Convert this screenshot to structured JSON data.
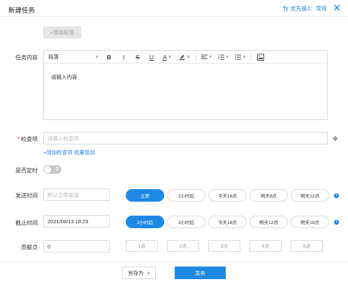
{
  "header": {
    "title": "新建任务",
    "priority_label": "优先级3：常规",
    "close_icon": "close-icon"
  },
  "tags": {
    "add_label": "+添加标签"
  },
  "content": {
    "label": "任务内容",
    "toolbar": {
      "paragraph": "段落",
      "bold": "B",
      "italic": "I",
      "strike": "S",
      "underline": "U",
      "font_color": "A",
      "highlight_icon": "highlighter-icon",
      "align_icon": "align-left-icon",
      "ordered_list_icon": "ordered-list-icon",
      "bullet_list_icon": "bullet-list-icon",
      "image_icon": "image-icon"
    },
    "placeholder": "请输入内容"
  },
  "checkitems": {
    "label": "检查项",
    "placeholder": "请输入检查项",
    "add_link": "+增加检查项",
    "bulk_link": "批量增加"
  },
  "scheduled": {
    "label": "是否定时",
    "toggle_text": "否",
    "toggle_on": false
  },
  "send_time": {
    "label": "发送时间",
    "placeholder": "默认立即发送",
    "options": [
      "立即",
      "2小时后",
      "今天18点",
      "明天8点",
      "明天12点"
    ],
    "selected": 0
  },
  "deadline": {
    "label": "截止时间",
    "value": "2021/08/13 18:29",
    "options": [
      "2小时后",
      "3小时后",
      "今天18点",
      "明天12点",
      "明天18点"
    ],
    "selected": 0
  },
  "points": {
    "label": "贡献点",
    "value": "0",
    "options": [
      "1点",
      "2点",
      "3点",
      "4点",
      "5点"
    ]
  },
  "footer": {
    "save_as": "另存为",
    "publish": "发布"
  },
  "colors": {
    "accent": "#1e88e5",
    "required": "#e53935"
  }
}
